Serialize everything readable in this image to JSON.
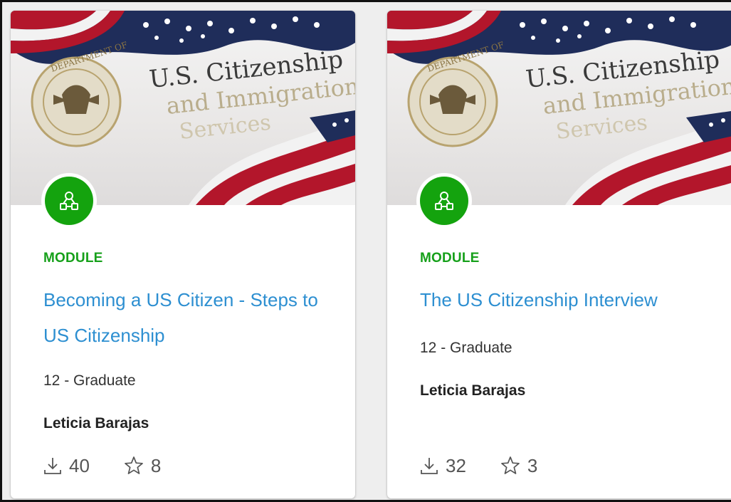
{
  "cards": [
    {
      "type_label": "MODULE",
      "title": "Becoming a US Citizen - Steps to US Citizenship",
      "grade": "12 - Graduate",
      "author": "Leticia Barajas",
      "downloads": "40",
      "favorites": "8",
      "thumbnail_text": {
        "line1": "U.S. Citizenship",
        "line2": "and Immigration",
        "line3": "Services",
        "seal_text": "DEPARTMENT OF"
      }
    },
    {
      "type_label": "MODULE",
      "title": "The US Citizenship Interview",
      "grade": "12 - Graduate",
      "author": "Leticia Barajas",
      "downloads": "32",
      "favorites": "3",
      "thumbnail_text": {
        "line1": "U.S. Citizenship",
        "line2": "and Immigration",
        "line3": "Services",
        "seal_text": "DEPARTMENT OF"
      }
    }
  ],
  "colors": {
    "module_green": "#14a30e",
    "title_blue": "#2d8fd1",
    "flag_red": "#b3162b",
    "flag_blue": "#20305e"
  },
  "icons": {
    "badge": "module-network-icon",
    "downloads": "download-icon",
    "favorites": "star-outline-icon"
  }
}
